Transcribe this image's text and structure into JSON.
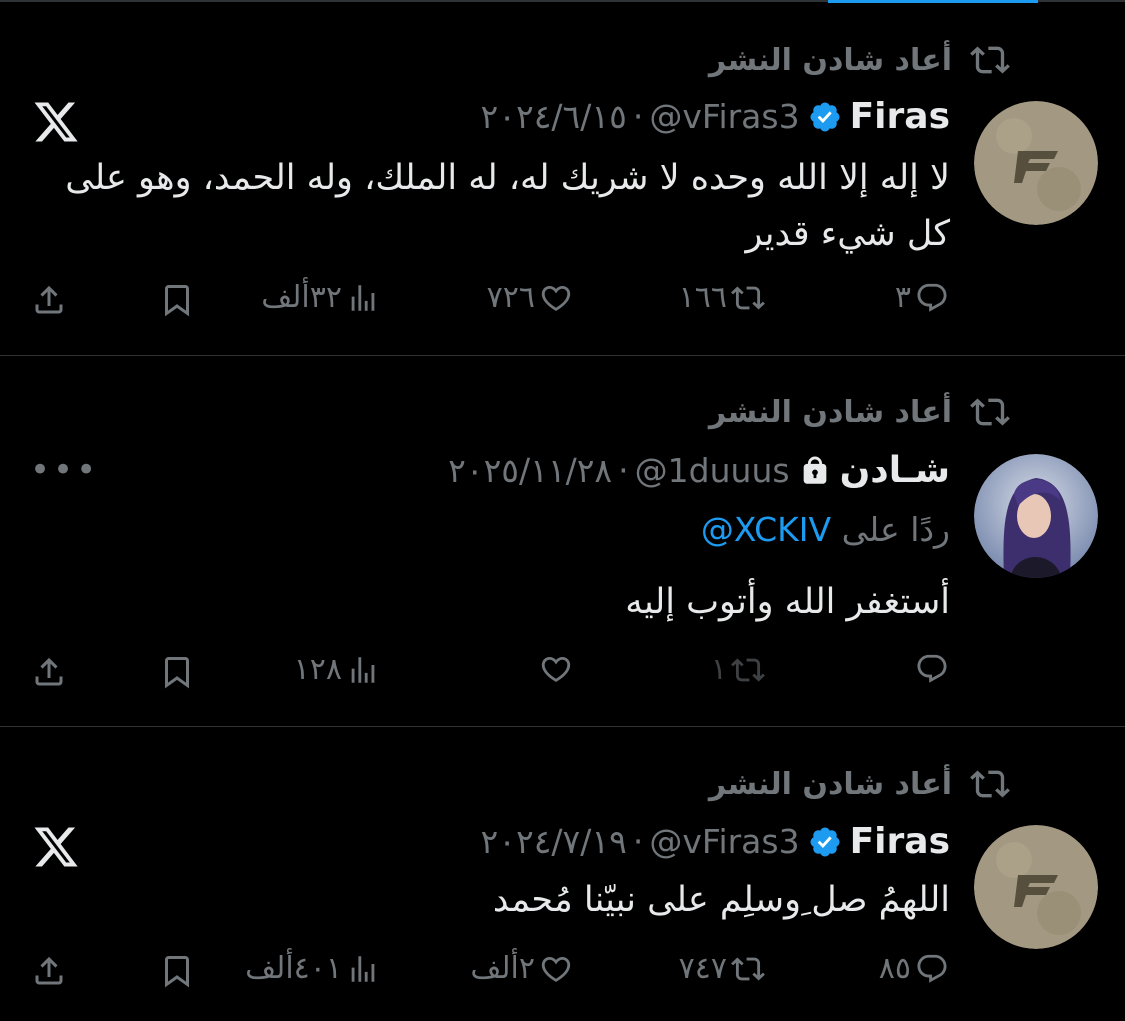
{
  "tweets": [
    {
      "retweet_label": "أعاد شادن النشر",
      "name": "Firas",
      "handle": "@vFiras3",
      "separator": "·",
      "date": "٢٠٢٤/٦/١٥",
      "text": "لا إله إلا الله وحده لا شريك له، له الملك، وله الحمد، وهو على كل شيء قدير",
      "reply_count": "٣",
      "retweet_count": "١٦٦",
      "like_count": "٧٢٦",
      "view_count": "٣٢ألف"
    },
    {
      "retweet_label": "أعاد شادن النشر",
      "name": "شـادن",
      "handle": "@1duuus",
      "separator": "·",
      "date": "٢٠٢٥/١١/٢٨",
      "reply_prefix": "ردًا على",
      "reply_mention": "@XCKIV",
      "text": "أستغفر الله وأتوب إليه",
      "retweet_count": "١",
      "view_count": "١٢٨",
      "more_label": "•••"
    },
    {
      "retweet_label": "أعاد شادن النشر",
      "name": "Firas",
      "handle": "@vFiras3",
      "separator": "·",
      "date": "٢٠٢٤/٧/١٩",
      "text": "اللهمُ صل ِوسلِم على نبيّنا مُحمد",
      "reply_count": "٨٥",
      "retweet_count": "٧٤٧",
      "like_count": "٢ألف",
      "view_count": "٤٠١ألف"
    }
  ],
  "colors": {
    "background": "#000000",
    "text": "#e7e9ea",
    "muted": "#71767b",
    "accent": "#1d9bf0",
    "divider": "#2f3336"
  }
}
